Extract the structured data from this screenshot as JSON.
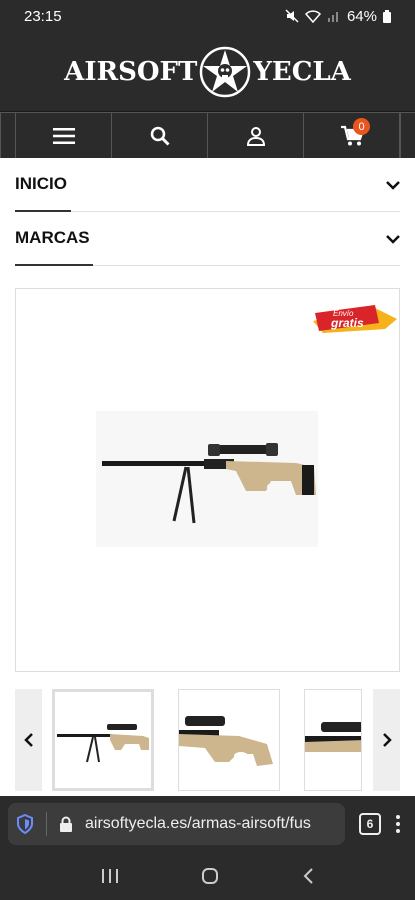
{
  "status": {
    "time": "23:15",
    "battery": "64%"
  },
  "header": {
    "logo_left": "AIRSOFT",
    "logo_right": "YECLA"
  },
  "cart": {
    "count": "0"
  },
  "accordion": [
    {
      "label": "INICIO"
    },
    {
      "label": "MARCAS"
    }
  ],
  "promo": {
    "line1": "Envío",
    "line2": "gratis"
  },
  "browser": {
    "url": "airsoftyecla.es/armas-airsoft/fus",
    "tabs": "6"
  },
  "colors": {
    "dark": "#2b2b2b",
    "accent": "#e8561d",
    "promo_red": "#d9252a",
    "promo_yellow": "#f5b21b",
    "tan": "#cdb68e"
  }
}
